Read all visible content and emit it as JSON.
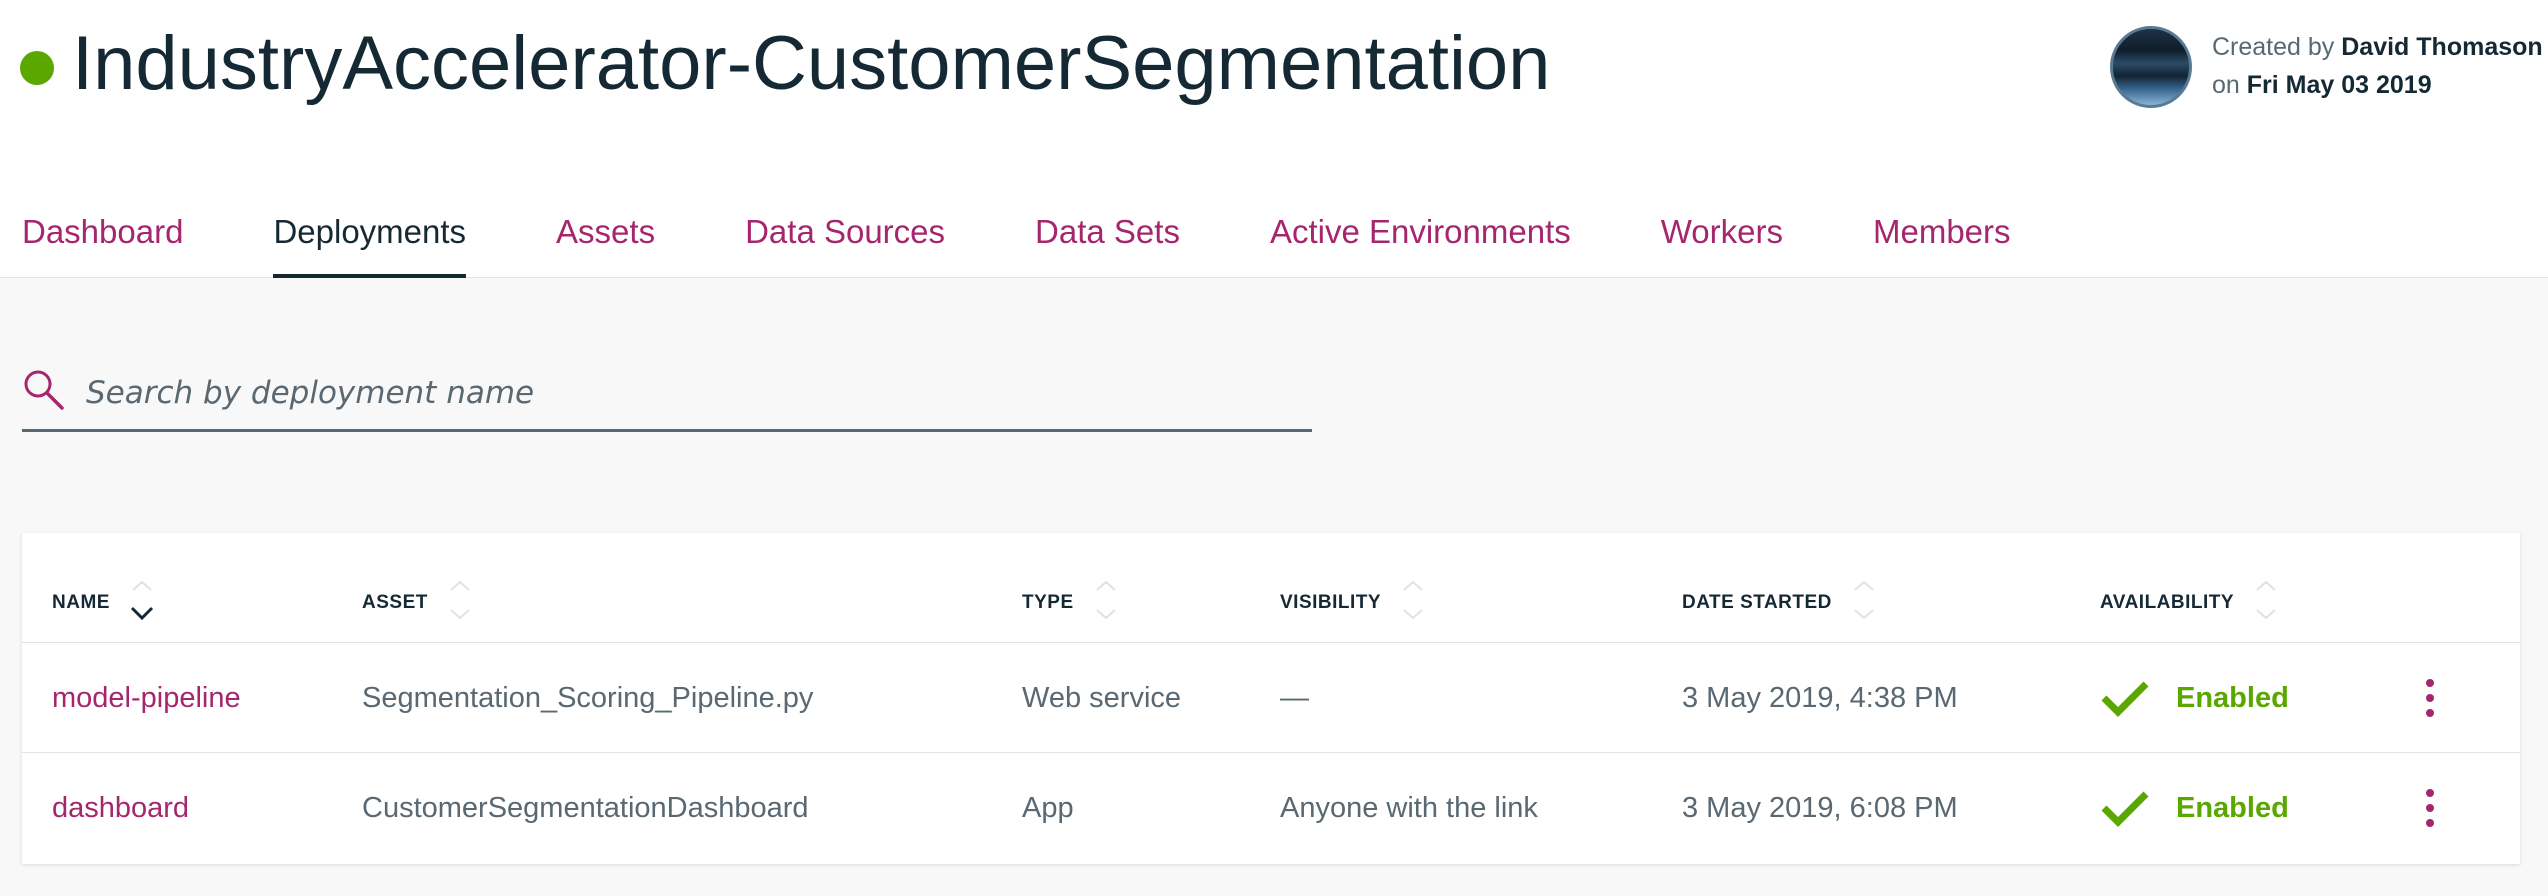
{
  "header": {
    "title": "IndustryAccelerator-CustomerSegmentation",
    "status_color": "#5aa700",
    "created_by_label": "Created by",
    "created_by_name": "David Thomason",
    "created_on_label": "on",
    "created_on_date": "Fri May 03 2019"
  },
  "tabs": [
    {
      "label": "Dashboard",
      "active": false
    },
    {
      "label": "Deployments",
      "active": true
    },
    {
      "label": "Assets",
      "active": false
    },
    {
      "label": "Data Sources",
      "active": false
    },
    {
      "label": "Data Sets",
      "active": false
    },
    {
      "label": "Active Environments",
      "active": false
    },
    {
      "label": "Workers",
      "active": false
    },
    {
      "label": "Members",
      "active": false
    }
  ],
  "search": {
    "placeholder": "Search by deployment name",
    "value": "",
    "icon": "search-icon"
  },
  "table": {
    "columns": [
      "NAME",
      "ASSET",
      "TYPE",
      "VISIBILITY",
      "DATE STARTED",
      "AVAILABILITY"
    ],
    "sorted_column": "NAME",
    "sort_direction": "descending",
    "rows": [
      {
        "name": "model-pipeline",
        "asset": "Segmentation_Scoring_Pipeline.py",
        "type": "Web service",
        "visibility": "—",
        "date_started": "3 May 2019, 4:38 PM",
        "availability": "Enabled"
      },
      {
        "name": "dashboard",
        "asset": "CustomerSegmentationDashboard",
        "type": "App",
        "visibility": "Anyone with the link",
        "date_started": "3 May 2019, 6:08 PM",
        "availability": "Enabled"
      }
    ]
  },
  "colors": {
    "accent": "#a6266e",
    "text_dark": "#152935",
    "text_muted": "#5a6872",
    "success": "#5aa700"
  }
}
